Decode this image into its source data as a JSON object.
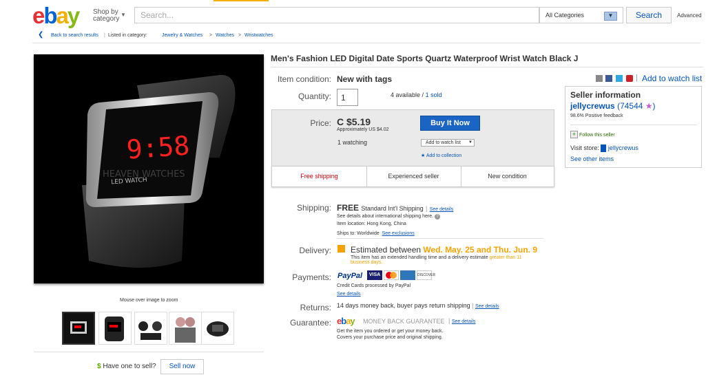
{
  "header": {
    "logo": {
      "e": "e",
      "b": "b",
      "a": "a",
      "y": "y"
    },
    "shop_by": "Shop by",
    "shop_by_2": "category",
    "search_placeholder": "Search...",
    "category_select": "All Categories",
    "search_button": "Search",
    "advanced": "Advanced"
  },
  "breadcrumb": {
    "back": "Back to search results",
    "listed_in": "Listed in category:",
    "items": [
      "Jewelry & Watches",
      "Watches",
      "Wristwatches"
    ]
  },
  "gallery": {
    "mouse_over": "Mouse over image to zoom",
    "watermark": "HEAVEN WATCHES",
    "display_time": "9:58",
    "thumbnail_count": 5
  },
  "item": {
    "title": "Men's Fashion LED Digital Date Sports Quartz Waterproof Wrist Watch Black J",
    "condition_label": "Item condition:",
    "condition_value": "New with tags",
    "add_to_watch": "Add to watch list",
    "quantity_label": "Quantity:",
    "quantity_value": "1",
    "available": "4 available /",
    "sold": "1 sold"
  },
  "price": {
    "label": "Price:",
    "value": "C $5.19",
    "approx": "Approximately US $4.02",
    "watching": "1 watching",
    "buy_now": "Buy It Now",
    "add_watch_select": "Add to watch list",
    "add_collection": "Add to collection"
  },
  "badges": [
    "Free shipping",
    "Experienced seller",
    "New condition"
  ],
  "seller": {
    "heading": "Seller information",
    "name": "jellycrewus",
    "feedback_count": "74544",
    "positive": "98.6% Positive feedback",
    "follow": "Follow this seller",
    "visit_store": "Visit store:",
    "store_name": "jellycrewus",
    "other_items": "See other items"
  },
  "shipping": {
    "label": "Shipping:",
    "free": "FREE",
    "method": "Standard Int'l Shipping",
    "see_details": "See details",
    "intl_note": "See details about international shipping here.",
    "location": "Item location: Hong Kong, China",
    "ships_to": "Ships to: Worldwide",
    "exclusions": "See exclusions"
  },
  "delivery": {
    "label": "Delivery:",
    "estimated": "Estimated between",
    "dates": "Wed. May. 25 and Thu. Jun. 9",
    "note": "This item has an extended handling time and a delivery estimate",
    "note_highlight": "greater than 11",
    "note_highlight_2": "business days."
  },
  "payments": {
    "label": "Payments:",
    "paypal": "PayPal",
    "cards": [
      "VISA",
      "MC",
      "AMEX",
      "DISCOVER"
    ],
    "credit_note": "Credit Cards processed by PayPal",
    "see_details": "See details"
  },
  "returns": {
    "label": "Returns:",
    "text": "14 days money back, buyer pays return shipping",
    "see_details": "See details"
  },
  "guarantee": {
    "label": "Guarantee:",
    "brand": "ebay",
    "mbg": "MONEY BACK GUARANTEE",
    "see_details": "See details",
    "line1": "Get the item you ordered or get your money back.",
    "line2": "Covers your purchase price and original shipping."
  },
  "sell": {
    "have_one": "Have one to sell?",
    "sell_now": "Sell now"
  },
  "colors": {
    "brand_blue": "#0654ba",
    "buy_button": "#1a64c4",
    "delivery_orange": "#f5a300",
    "free_shipping_red": "#c7000b"
  }
}
